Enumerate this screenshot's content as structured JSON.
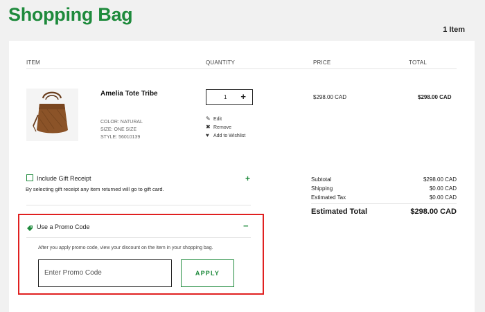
{
  "page": {
    "title": "Shopping Bag",
    "item_count": "1 Item"
  },
  "table": {
    "headers": {
      "item": "ITEM",
      "quantity": "QUANTITY",
      "price": "PRICE",
      "total": "TOTAL"
    }
  },
  "product": {
    "name": "Amelia Tote Tribe",
    "color": "COLOR: NATURAL",
    "size": "SIZE: ONE SIZE",
    "style": "STYLE: 56010139",
    "quantity": "1",
    "price": "$298.00 CAD",
    "total": "$298.00 CAD",
    "actions": {
      "edit": "Edit",
      "remove": "Remove",
      "wishlist": "Add to Wishlist"
    }
  },
  "gift": {
    "label": "Include Gift Receipt",
    "note": "By selecting gift receipt any item returned will go to gift card.",
    "toggle": "+"
  },
  "summary": {
    "subtotal_label": "Subtotal",
    "subtotal": "$298.00 CAD",
    "shipping_label": "Shipping",
    "shipping": "$0.00 CAD",
    "tax_label": "Estimated Tax",
    "tax": "$0.00 CAD",
    "total_label": "Estimated Total",
    "total": "$298.00 CAD"
  },
  "promo": {
    "label": "Use a Promo Code",
    "toggle": "−",
    "note": "After you apply promo code, view your discount on the item in your shopping bag.",
    "placeholder": "Enter Promo Code",
    "apply": "APPLY"
  },
  "colors": {
    "brand": "#1e8a3c",
    "highlight": "#e02020"
  }
}
